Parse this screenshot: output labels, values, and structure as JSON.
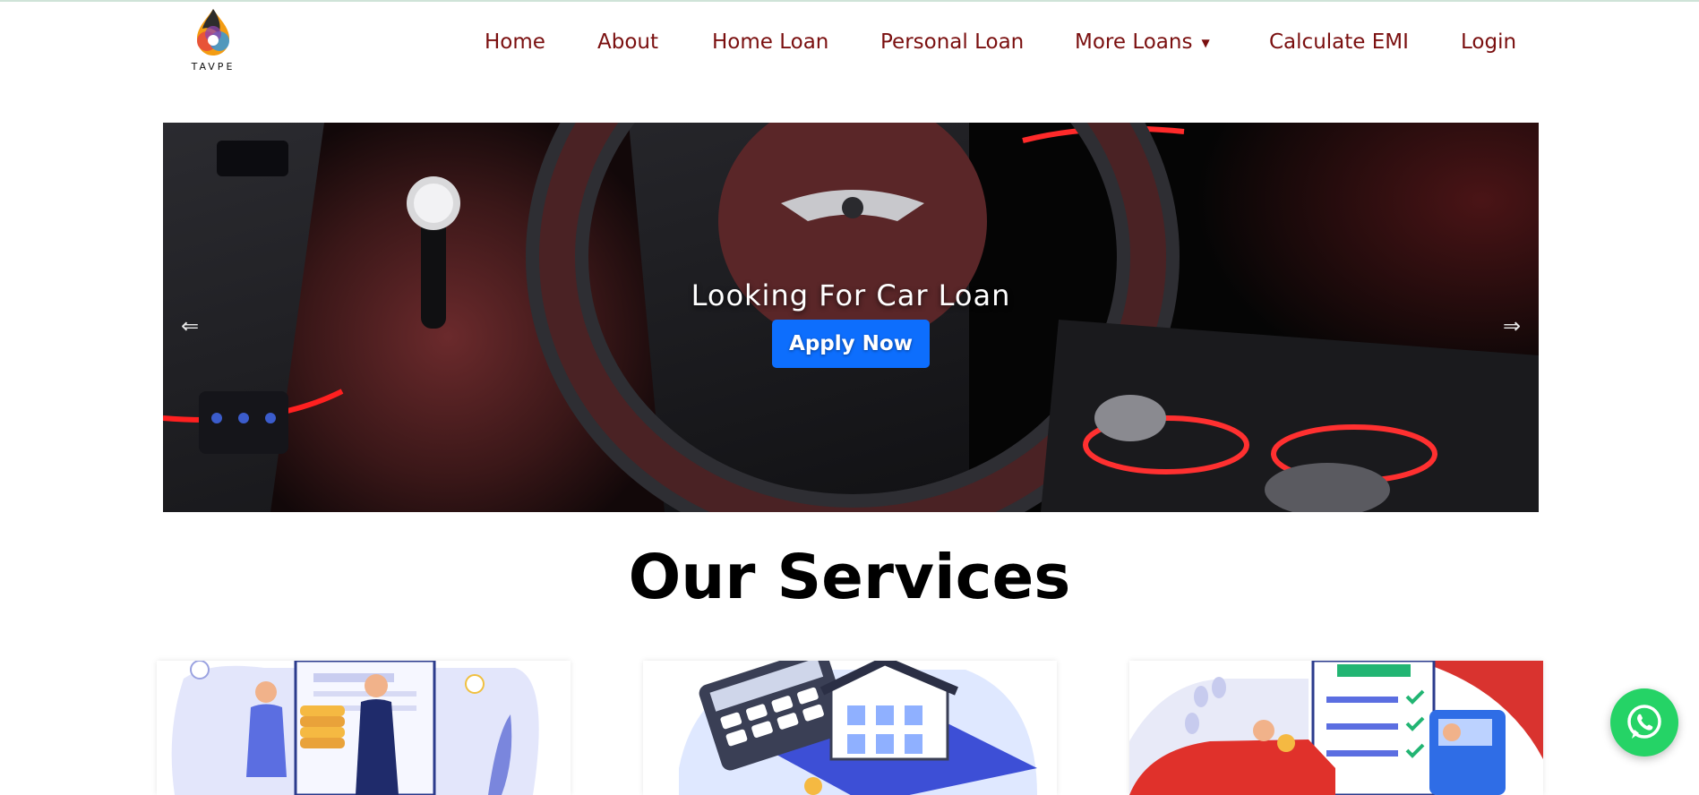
{
  "brand": {
    "logo_text": "TAVPE"
  },
  "nav": {
    "items": [
      {
        "label": "Home"
      },
      {
        "label": "About"
      },
      {
        "label": "Home Loan"
      },
      {
        "label": "Personal Loan"
      },
      {
        "label": "More Loans",
        "caret": "▼"
      },
      {
        "label": "Calculate EMI"
      },
      {
        "label": "Login"
      }
    ]
  },
  "carousel": {
    "caption": "Looking For Car Loan",
    "button_label": "Apply Now",
    "prev_icon": "⇐",
    "next_icon": "⇒"
  },
  "services": {
    "title": "Our Services",
    "cards": [
      {
        "illustration": "coin-exchange-illustration"
      },
      {
        "illustration": "calculator-house-illustration"
      },
      {
        "illustration": "car-checklist-illustration"
      }
    ]
  },
  "floating": {
    "icon": "whatsapp-icon"
  },
  "colors": {
    "nav_text": "#7a0f0f",
    "primary_button": "#0d6efd",
    "whatsapp": "#25d366"
  }
}
